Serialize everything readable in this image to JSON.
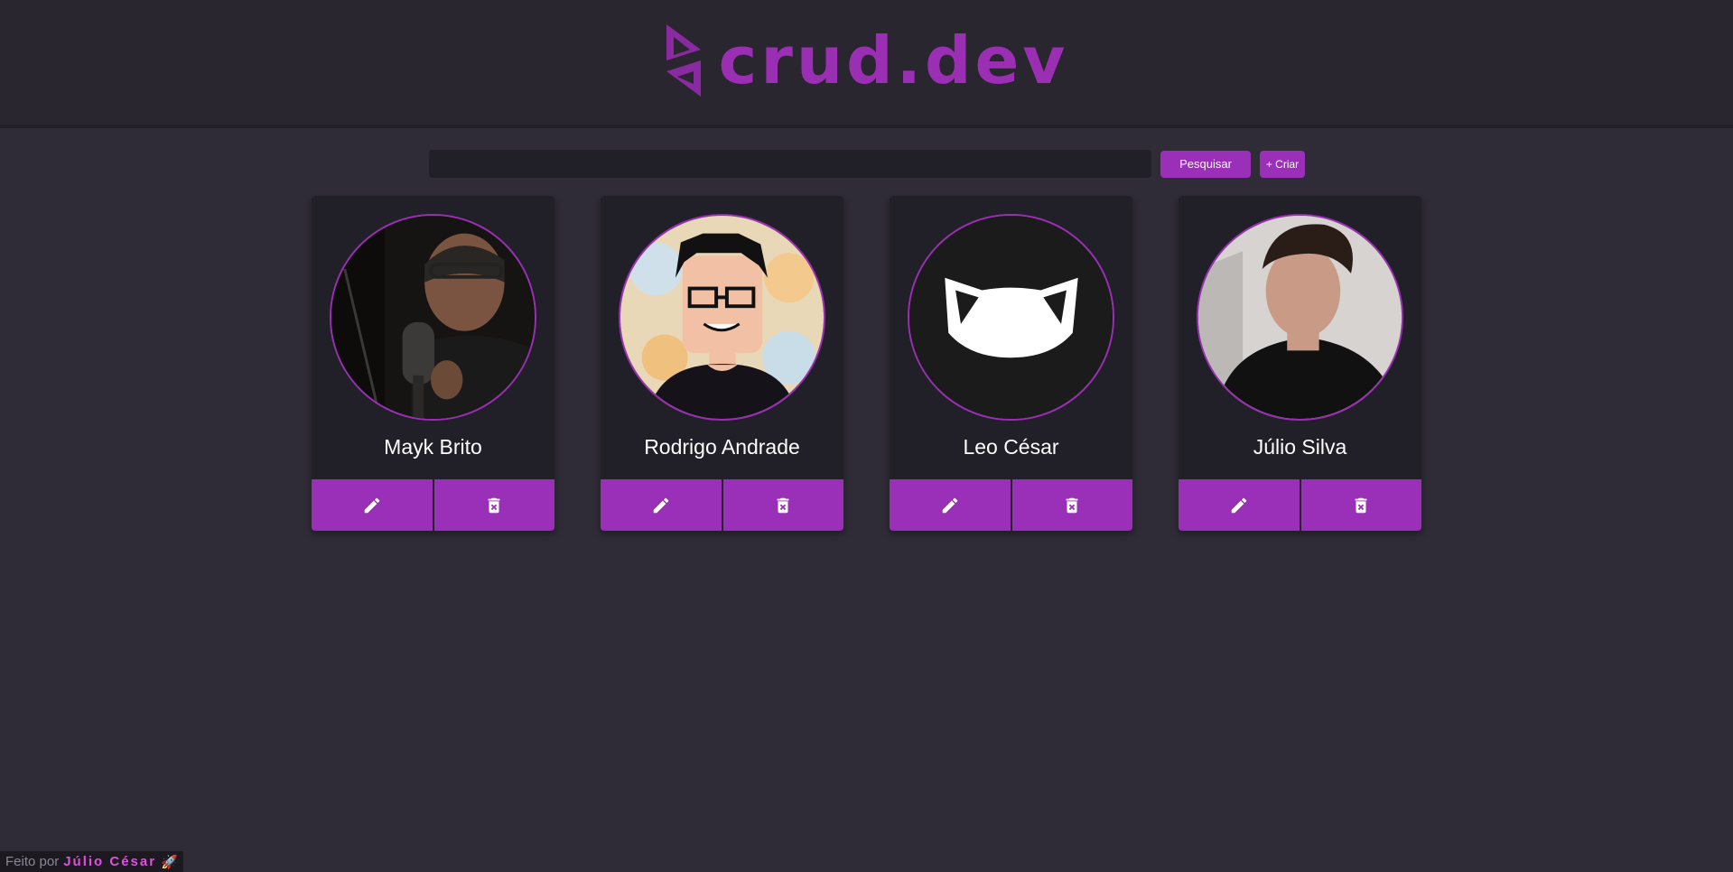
{
  "header": {
    "brand": "crud.dev",
    "logo_icon": "triangles-logo-icon",
    "brand_color": "#9b2fb4"
  },
  "toolbar": {
    "search_value": "",
    "search_label": "Pesquisar",
    "create_label": "+ Criar"
  },
  "cards": [
    {
      "name": "Mayk Brito",
      "avatar": "photo",
      "edit_icon": "pencil-icon",
      "delete_icon": "trash-icon"
    },
    {
      "name": "Rodrigo Andrade",
      "avatar": "pixel-art",
      "edit_icon": "pencil-icon",
      "delete_icon": "trash-icon"
    },
    {
      "name": "Leo César",
      "avatar": "cat-mask",
      "edit_icon": "pencil-icon",
      "delete_icon": "trash-icon"
    },
    {
      "name": "Júlio Silva",
      "avatar": "photo",
      "edit_icon": "pencil-icon",
      "delete_icon": "trash-icon"
    }
  ],
  "footer": {
    "prefix": "Feito por",
    "author": "Júlio César",
    "rocket": "🚀"
  },
  "colors": {
    "background": "#2f2b37",
    "header": "#29262f",
    "card": "#211f28",
    "accent": "#9a2fb8"
  }
}
